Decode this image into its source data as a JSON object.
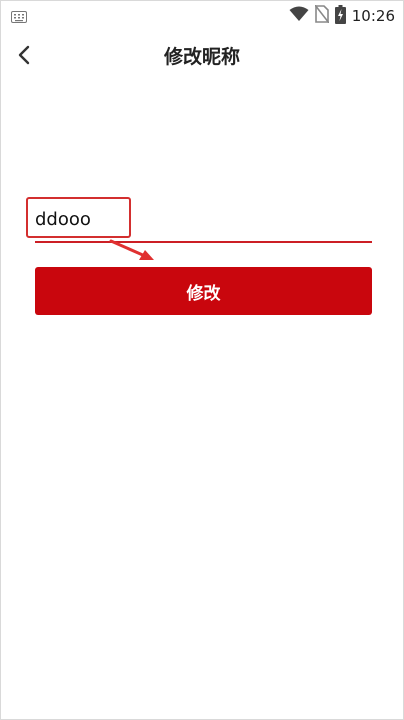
{
  "status_bar": {
    "time": "10:26",
    "icons": [
      "keyboard-icon",
      "wifi-icon",
      "no-sim-icon",
      "battery-charging-icon"
    ]
  },
  "header": {
    "title": "修改昵称",
    "back_icon": "chevron-left-icon"
  },
  "form": {
    "nickname_value": "ddooo",
    "submit_label": "修改"
  },
  "colors": {
    "accent": "#c9060d",
    "underline": "#cc1f25",
    "highlight": "#d32f2f"
  }
}
